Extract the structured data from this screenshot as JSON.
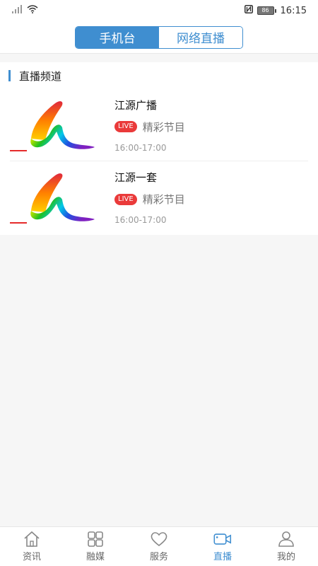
{
  "status_bar": {
    "time": "16:15",
    "battery": "86"
  },
  "header": {
    "tabs": [
      {
        "label": "手机台",
        "active": true
      },
      {
        "label": "网络直播",
        "active": false
      }
    ]
  },
  "section": {
    "title": "直播频道"
  },
  "channels": [
    {
      "name": "江源广播",
      "live_badge": "LIVE",
      "program": "精彩节目",
      "time": "16:00-17:00"
    },
    {
      "name": "江源一套",
      "live_badge": "LIVE",
      "program": "精彩节目",
      "time": "16:00-17:00"
    }
  ],
  "tab_bar": {
    "items": [
      {
        "label": "资讯",
        "icon": "home-icon"
      },
      {
        "label": "融媒",
        "icon": "grid-icon"
      },
      {
        "label": "服务",
        "icon": "heart-icon"
      },
      {
        "label": "直播",
        "icon": "video-camera-icon",
        "active": true
      },
      {
        "label": "我的",
        "icon": "user-icon"
      }
    ]
  },
  "colors": {
    "accent": "#3f8ed0",
    "live_red": "#ea3a3a"
  }
}
